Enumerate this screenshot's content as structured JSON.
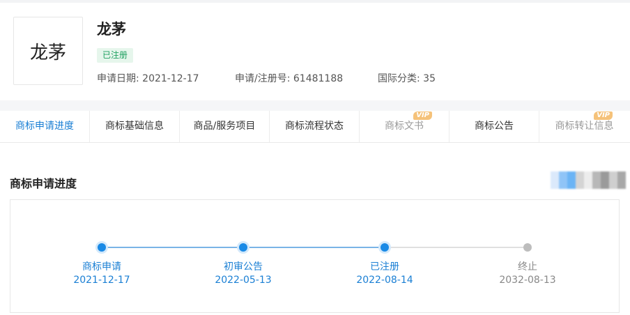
{
  "trademark": {
    "logo_text": "龙茅",
    "name": "龙茅",
    "status": "已注册",
    "application_date_label": "申请日期: 2021-12-17",
    "registration_number_label": "申请/注册号: 61481188",
    "intl_class_label": "国际分类: 35"
  },
  "tabs": [
    {
      "label": "商标申请进度",
      "active": true,
      "vip": false
    },
    {
      "label": "商标基础信息",
      "active": false,
      "vip": false
    },
    {
      "label": "商品/服务项目",
      "active": false,
      "vip": false
    },
    {
      "label": "商标流程状态",
      "active": false,
      "vip": false
    },
    {
      "label": "商标文书",
      "active": false,
      "vip": true
    },
    {
      "label": "商标公告",
      "active": false,
      "vip": false
    },
    {
      "label": "商标转让信息",
      "active": false,
      "vip": true
    }
  ],
  "vip_badge": "VIP",
  "section": {
    "title": "商标申请进度"
  },
  "progress": {
    "steps": [
      {
        "label": "商标申请",
        "date": "2021-12-17",
        "done": true
      },
      {
        "label": "初审公告",
        "date": "2022-05-13",
        "done": true
      },
      {
        "label": "已注册",
        "date": "2022-08-14",
        "done": true
      },
      {
        "label": "终止",
        "date": "2032-08-13",
        "done": false
      }
    ]
  },
  "colors": {
    "accent": "#1a7fd4",
    "done_line": "#7ab4e6",
    "pending_line": "#e0e0e0",
    "vip": "#f5c27a",
    "status_green": "#1fa060"
  }
}
